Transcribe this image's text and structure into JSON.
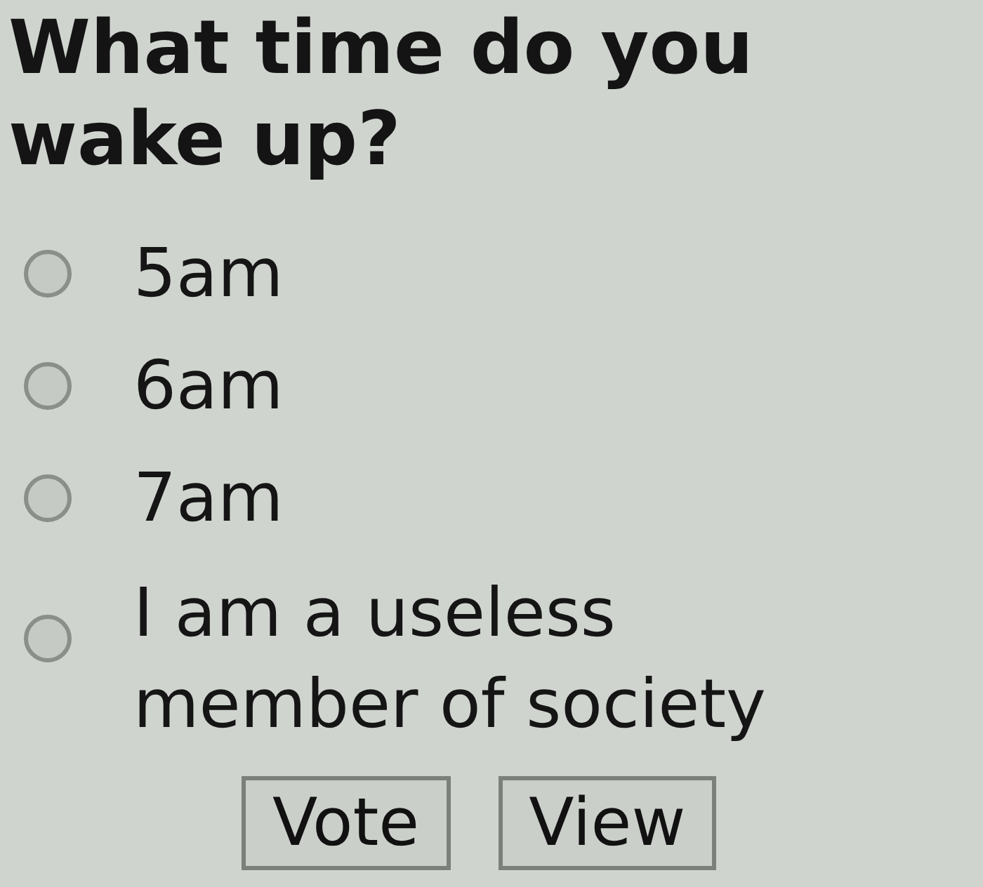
{
  "poll": {
    "question": "What time do you wake up?",
    "options": [
      {
        "label": "5am",
        "selected": false
      },
      {
        "label": "6am",
        "selected": false
      },
      {
        "label": "7am",
        "selected": false
      },
      {
        "label": "I am a useless member of society",
        "selected": false
      }
    ],
    "buttons": [
      "Vote",
      "View"
    ]
  }
}
